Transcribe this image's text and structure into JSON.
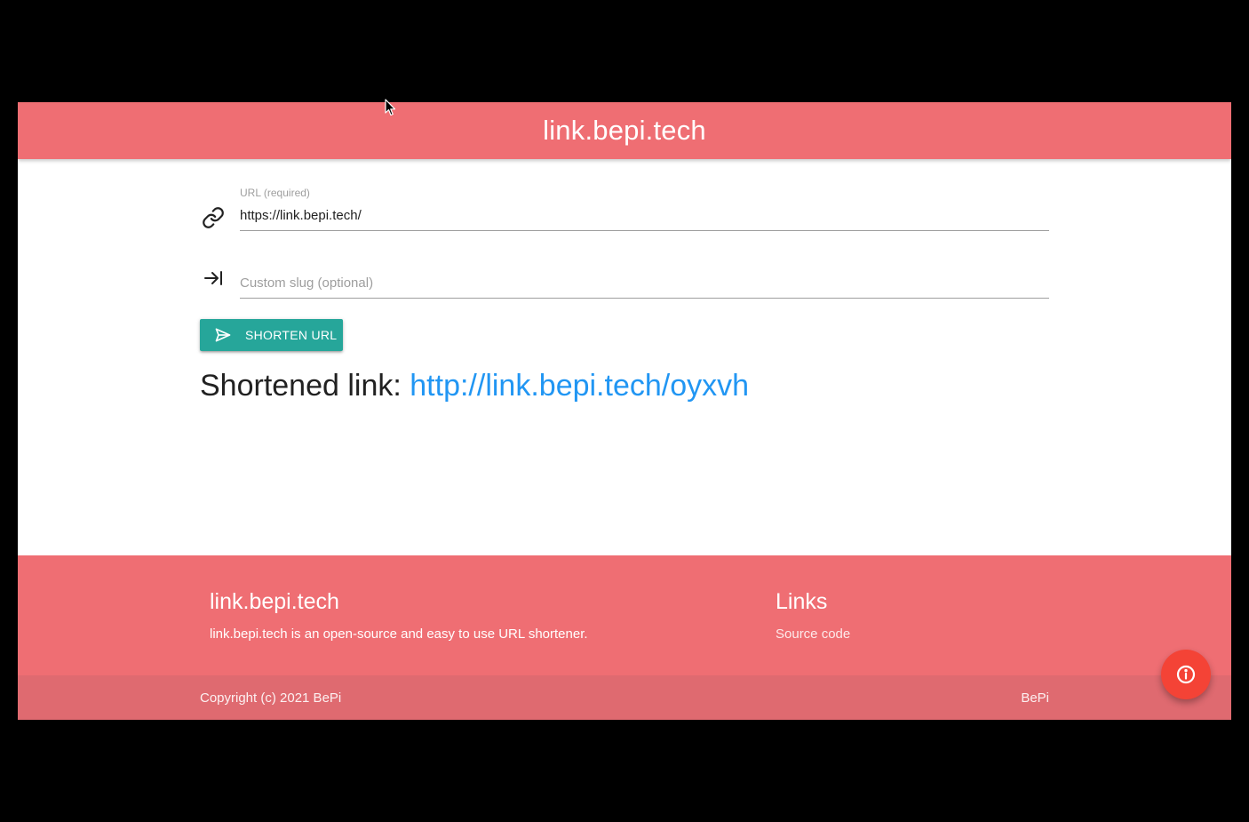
{
  "navbar": {
    "brand": "link.bepi.tech"
  },
  "form": {
    "url": {
      "label": "URL (required)",
      "value": "https://link.bepi.tech/",
      "icon": "link-icon"
    },
    "slug": {
      "placeholder": "Custom slug (optional)",
      "value": "",
      "icon": "arrow-right-to-bar-icon"
    },
    "submit": {
      "label": "SHORTEN URL",
      "icon": "send-icon"
    }
  },
  "result": {
    "prefix": "Shortened link: ",
    "link": "http://link.bepi.tech/oyxvh"
  },
  "footer": {
    "about": {
      "title": "link.bepi.tech",
      "text": "link.bepi.tech is an open-source and easy to use URL shortener."
    },
    "links": {
      "title": "Links",
      "items": [
        "Source code"
      ]
    },
    "copyright": "Copyright (c) 2021 BePi",
    "credit": "BePi"
  },
  "fab": {
    "icon": "info-icon"
  },
  "colors": {
    "primary": "#ef6e73",
    "footer_copyright": "#df6a70",
    "button": "#26a69a",
    "link": "#2196f3",
    "fab": "#f44336"
  }
}
